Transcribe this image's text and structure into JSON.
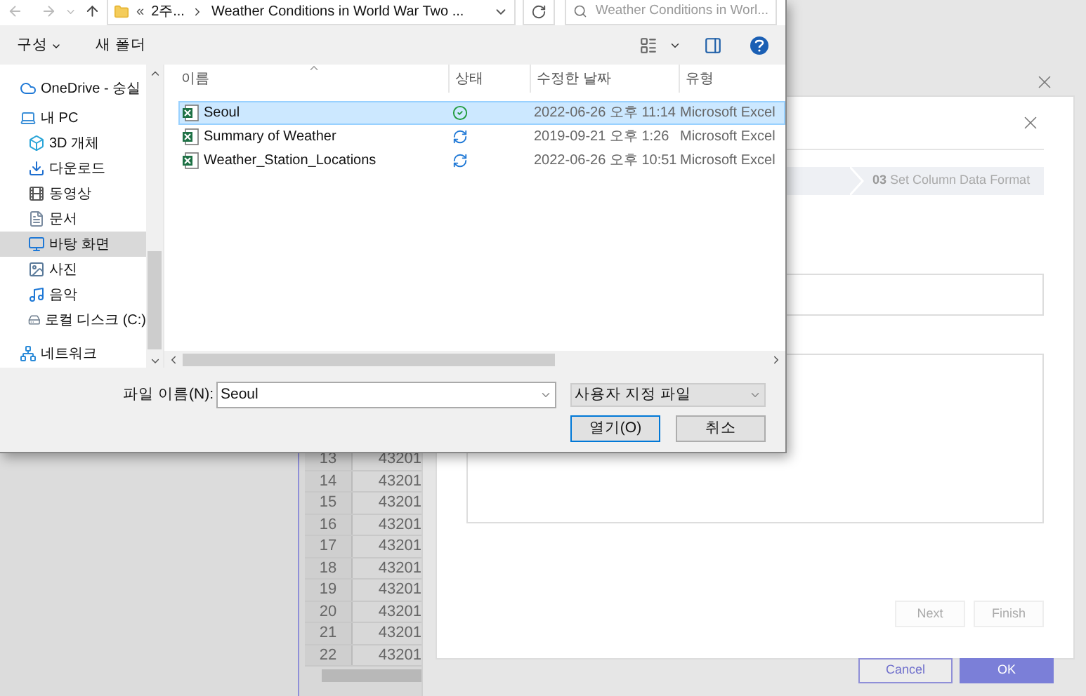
{
  "file_dialog": {
    "address": {
      "overflow": "«",
      "path": [
        "2주...",
        "Weather Conditions in World War Two ..."
      ]
    },
    "search": {
      "placeholder": "Weather Conditions in Worl..."
    },
    "toolbar": {
      "organize": "구성",
      "new_folder": "새 폴더"
    },
    "nav": [
      {
        "label": "OneDrive - 숭실",
        "selected": false
      },
      {
        "label": "내 PC",
        "selected": false,
        "children": [
          {
            "label": "3D 개체",
            "selected": false
          },
          {
            "label": "다운로드",
            "selected": false
          },
          {
            "label": "동영상",
            "selected": false
          },
          {
            "label": "문서",
            "selected": false
          },
          {
            "label": "바탕 화면",
            "selected": true
          },
          {
            "label": "사진",
            "selected": false
          },
          {
            "label": "음악",
            "selected": false
          },
          {
            "label": "로컬 디스크 (C:)",
            "selected": false
          }
        ]
      },
      {
        "label": "네트워크",
        "selected": false
      }
    ],
    "columns": [
      "이름",
      "상태",
      "수정한 날짜",
      "유형"
    ],
    "files": [
      {
        "name": "Seoul",
        "synced": true,
        "modified": "2022-06-26 오후 11:14",
        "type": "Microsoft Excel",
        "selected": true
      },
      {
        "name": "Summary of Weather",
        "synced": false,
        "modified": "2019-09-21 오후 1:26",
        "type": "Microsoft Excel",
        "selected": false
      },
      {
        "name": "Weather_Station_Locations",
        "synced": false,
        "modified": "2022-06-26 오후 10:51",
        "type": "Microsoft Excel",
        "selected": false
      }
    ],
    "filename": {
      "label": "파일 이름(N):",
      "value": "Seoul"
    },
    "filter": "사용자 지정 파일",
    "buttons": [
      {
        "label": "열기(O)",
        "primary": true
      },
      {
        "label": "취소",
        "primary": false
      }
    ]
  },
  "spreadsheet": {
    "rows": [
      {
        "number": "13",
        "value": "43201"
      },
      {
        "number": "14",
        "value": "43201"
      },
      {
        "number": "15",
        "value": "43201"
      },
      {
        "number": "16",
        "value": "43201"
      },
      {
        "number": "17",
        "value": "43201"
      },
      {
        "number": "18",
        "value": "43201"
      },
      {
        "number": "19",
        "value": "43201"
      },
      {
        "number": "20",
        "value": "43201"
      },
      {
        "number": "21",
        "value": "43201"
      },
      {
        "number": "22",
        "value": "43201"
      }
    ]
  },
  "wizard": {
    "step": {
      "number": "03",
      "label": "Set Column Data Format"
    },
    "buttons": [
      {
        "label": "Next",
        "disabled": true
      },
      {
        "label": "Finish",
        "disabled": true
      }
    ]
  },
  "footer_buttons": [
    {
      "label": "Cancel",
      "primary": false
    },
    {
      "label": "OK",
      "primary": true
    }
  ]
}
